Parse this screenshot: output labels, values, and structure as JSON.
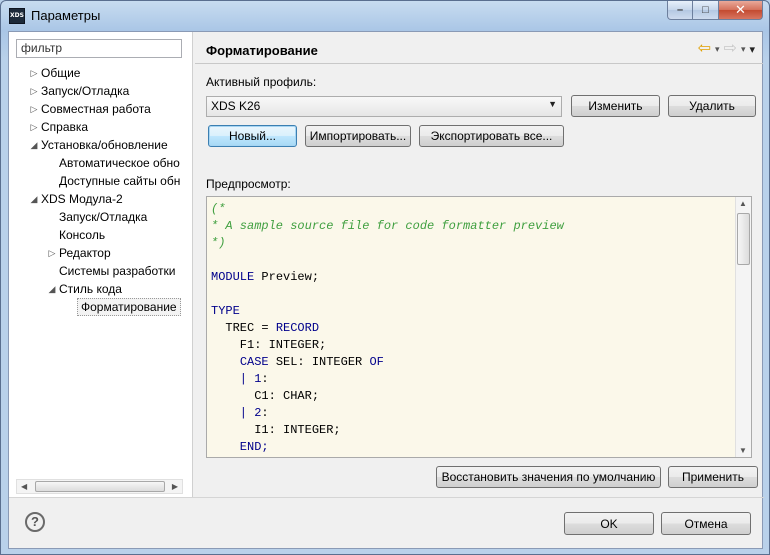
{
  "window": {
    "app_icon_text": "XDS",
    "title": "Параметры",
    "minimize": "–",
    "maximize": "□",
    "close": "✕"
  },
  "sidebar": {
    "filter_text": "фильтр",
    "items": [
      {
        "label": "Общие",
        "level": 0,
        "arrow": "▷"
      },
      {
        "label": "Запуск/Отладка",
        "level": 0,
        "arrow": "▷"
      },
      {
        "label": "Совместная работа",
        "level": 0,
        "arrow": "▷"
      },
      {
        "label": "Справка",
        "level": 0,
        "arrow": "▷"
      },
      {
        "label": "Установка/обновление",
        "level": 0,
        "arrow": "◢"
      },
      {
        "label": "Автоматическое обно",
        "level": 1,
        "arrow": ""
      },
      {
        "label": "Доступные сайты обн",
        "level": 1,
        "arrow": ""
      },
      {
        "label": "XDS Модула-2",
        "level": 0,
        "arrow": "◢"
      },
      {
        "label": "Запуск/Отладка",
        "level": 1,
        "arrow": ""
      },
      {
        "label": "Консоль",
        "level": 1,
        "arrow": ""
      },
      {
        "label": "Редактор",
        "level": 1,
        "arrow": "▷"
      },
      {
        "label": "Системы разработки",
        "level": 1,
        "arrow": ""
      },
      {
        "label": "Стиль кода",
        "level": 1,
        "arrow": "◢"
      },
      {
        "label": "Форматирование",
        "level": 2,
        "arrow": "",
        "selected": true
      }
    ]
  },
  "main": {
    "title": "Форматирование",
    "nav": {
      "back": "⇦",
      "fwd": "⇨",
      "dropdown": "▾",
      "menu": "▾"
    },
    "profile_label": "Активный профиль:",
    "profile_value": "XDS K26",
    "combo_arrow": "▼",
    "buttons": {
      "edit": "Изменить",
      "delete": "Удалить",
      "new": "Новый...",
      "import": "Импортировать...",
      "export": "Экспортировать все..."
    },
    "preview_label": "Предпросмотр:",
    "code_lines": [
      [
        {
          "t": "(*",
          "k": "c"
        }
      ],
      [
        {
          "t": "* A sample source file for code formatter preview",
          "k": "c"
        }
      ],
      [
        {
          "t": "*)",
          "k": "c"
        }
      ],
      [
        {
          "t": "",
          "k": "t"
        }
      ],
      [
        {
          "t": "MODULE",
          "k": "k"
        },
        {
          "t": " Preview;",
          "k": "t"
        }
      ],
      [
        {
          "t": "",
          "k": "t"
        }
      ],
      [
        {
          "t": "TYPE",
          "k": "k"
        }
      ],
      [
        {
          "t": "  TREC = ",
          "k": "t"
        },
        {
          "t": "RECORD",
          "k": "k"
        }
      ],
      [
        {
          "t": "    F1: INTEGER;",
          "k": "t"
        }
      ],
      [
        {
          "t": "    ",
          "k": "t"
        },
        {
          "t": "CASE",
          "k": "k"
        },
        {
          "t": " SEL: INTEGER ",
          "k": "t"
        },
        {
          "t": "OF",
          "k": "k"
        }
      ],
      [
        {
          "t": "    | ",
          "k": "k"
        },
        {
          "t": "1",
          "k": "k"
        },
        {
          "t": ":",
          "k": "t"
        }
      ],
      [
        {
          "t": "      C1: CHAR;",
          "k": "t"
        }
      ],
      [
        {
          "t": "    | ",
          "k": "k"
        },
        {
          "t": "2",
          "k": "k"
        },
        {
          "t": ":",
          "k": "t"
        }
      ],
      [
        {
          "t": "      I1: INTEGER;",
          "k": "t"
        }
      ],
      [
        {
          "t": "    END;",
          "k": "k"
        }
      ]
    ],
    "restore_defaults": "Восстановить значения по умолчанию",
    "apply": "Применить"
  },
  "footer": {
    "help": "?",
    "ok": "OK",
    "cancel": "Отмена"
  }
}
